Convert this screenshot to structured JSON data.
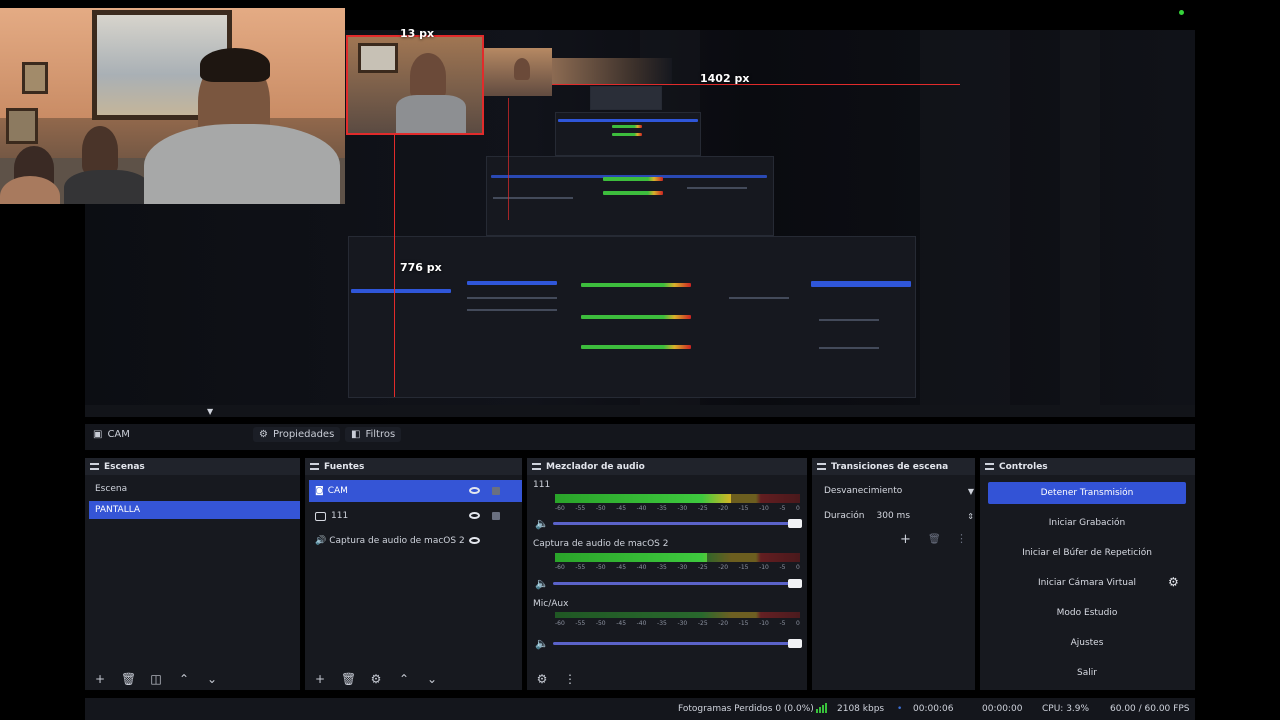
{
  "preview": {
    "measure_top": "13 px",
    "measure_right": "1402 px",
    "measure_left": "776 px"
  },
  "source_toolbar": {
    "source_name": "CAM",
    "properties_label": "Propiedades",
    "filters_label": "Filtros"
  },
  "scenes": {
    "title": "Escenas",
    "items": [
      {
        "label": "Escena",
        "selected": false
      },
      {
        "label": "PANTALLA",
        "selected": true
      }
    ]
  },
  "sources": {
    "title": "Fuentes",
    "items": [
      {
        "label": "CAM",
        "icon": "camera-icon",
        "selected": true
      },
      {
        "label": "111",
        "icon": "display-icon",
        "selected": false
      },
      {
        "label": "Captura de audio de macOS 2",
        "icon": "speaker-icon",
        "selected": false
      }
    ]
  },
  "mixer": {
    "title": "Mezclador de audio",
    "tick_labels": [
      "-60",
      "-55",
      "-50",
      "-45",
      "-40",
      "-35",
      "-30",
      "-25",
      "-20",
      "-15",
      "-10",
      "-5",
      "0"
    ],
    "channels": [
      {
        "name": "111",
        "level_fraction": 0.72
      },
      {
        "name": "Captura de audio de macOS 2",
        "level_fraction": 0.62
      },
      {
        "name": "Mic/Aux",
        "level_fraction": 0.0
      }
    ]
  },
  "transitions": {
    "title": "Transiciones de escena",
    "selected": "Desvanecimiento",
    "duration_label": "Duración",
    "duration_value": "300 ms"
  },
  "controls": {
    "title": "Controles",
    "buttons": [
      "Detener Transmisión",
      "Iniciar Grabación",
      "Iniciar el Búfer de Repetición",
      "Iniciar Cámara Virtual",
      "Modo Estudio",
      "Ajustes",
      "Salir"
    ]
  },
  "status": {
    "dropped_frames": "Fotogramas Perdidos 0 (0.0%)",
    "bitrate": "2108 kbps",
    "stream_time": "00:00:06",
    "rec_time": "00:00:00",
    "cpu": "CPU: 3.9%",
    "fps": "60.00 / 60.00 FPS"
  },
  "colors": {
    "accent": "#3353d6",
    "meter_green": "#3ec93e",
    "meter_yellow": "#d7b525",
    "meter_red": "#c42828"
  }
}
